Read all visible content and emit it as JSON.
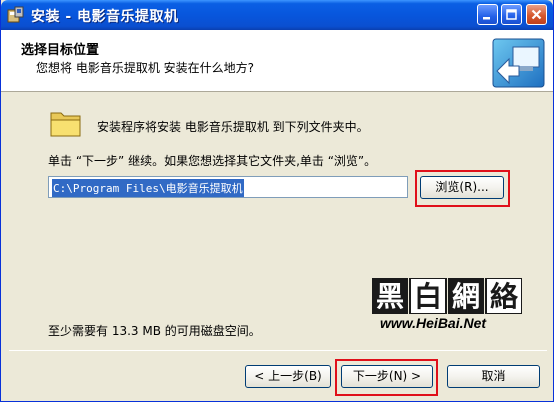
{
  "window": {
    "title": "安装 - 电影音乐提取机"
  },
  "header": {
    "title": "选择目标位置",
    "subtitle": "您想将 电影音乐提取机 安装在什么地方?"
  },
  "body": {
    "intro": "安装程序将安装 电影音乐提取机 到下列文件夹中。",
    "instruction": "单击 “下一步” 继续。如果您想选择其它文件夹,单击 “浏览”。",
    "path_value": "C:\\Program Files\\电影音乐提取机",
    "browse_label": "浏览(R)...",
    "space_note": "至少需要有 13.3 MB 的可用磁盘空间。"
  },
  "watermark": {
    "chars": "黑白網絡",
    "url": "www.HeiBai.Net"
  },
  "footer": {
    "back_label": "< 上一步(B)",
    "next_label": "下一步(N) >",
    "cancel_label": "取消"
  },
  "colors": {
    "titlebar": "#0856dd",
    "highlight": "#e0101a",
    "selection": "#316ac5"
  }
}
